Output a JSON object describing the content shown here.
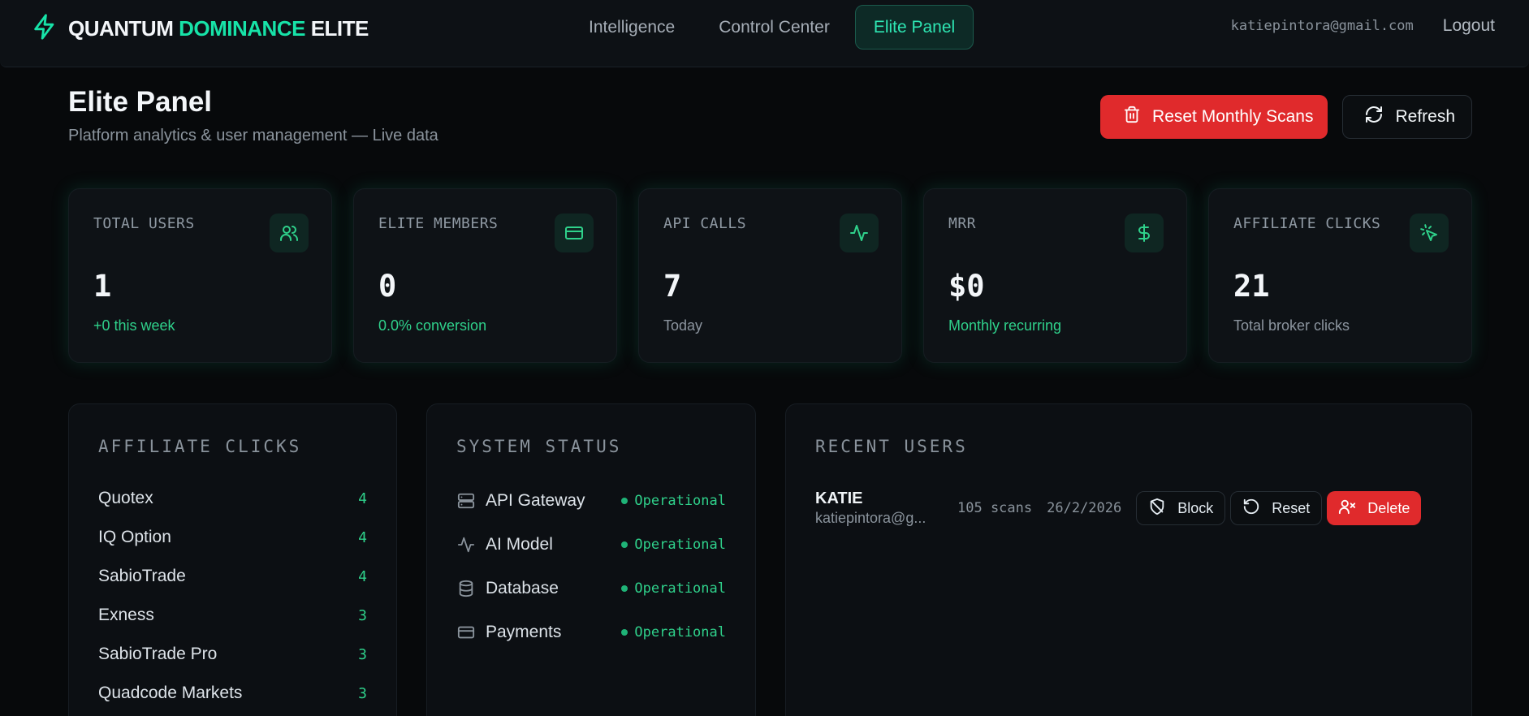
{
  "brand": {
    "part1": "QUANTUM",
    "part2": "DOMINANCE",
    "part3": "ELITE",
    "accent": "#17e3a8",
    "icon": "lightning-icon"
  },
  "nav": {
    "links": [
      {
        "label": "Intelligence"
      },
      {
        "label": "Control Center"
      },
      {
        "label": "Elite Panel",
        "active": true
      }
    ],
    "email": "katiepintora@gmail.com",
    "logout": "Logout"
  },
  "header": {
    "title": "Elite Panel",
    "subtitle": "Platform analytics & user management — Live data",
    "reset_label": "Reset Monthly Scans",
    "refresh_label": "Refresh"
  },
  "stats": [
    {
      "label": "TOTAL USERS",
      "value": "1",
      "sub": "+0 this week",
      "icon": "users-icon"
    },
    {
      "label": "ELITE MEMBERS",
      "value": "0",
      "sub": "0.0% conversion",
      "icon": "credit-card-icon"
    },
    {
      "label": "API CALLS",
      "value": "7",
      "sub": "Today",
      "icon": "activity-icon"
    },
    {
      "label": "MRR",
      "value": "$0",
      "sub": "Monthly recurring",
      "icon": "dollar-icon"
    },
    {
      "label": "AFFILIATE CLICKS",
      "value": "21",
      "sub": "Total broker clicks",
      "icon": "pointer-click-icon"
    }
  ],
  "affiliate": {
    "title": "AFFILIATE CLICKS",
    "items": [
      {
        "name": "Quotex",
        "count": "4"
      },
      {
        "name": "IQ Option",
        "count": "4"
      },
      {
        "name": "SabioTrade",
        "count": "4"
      },
      {
        "name": "Exness",
        "count": "3"
      },
      {
        "name": "SabioTrade Pro",
        "count": "3"
      },
      {
        "name": "Quadcode Markets",
        "count": "3"
      }
    ]
  },
  "system": {
    "title": "SYSTEM STATUS",
    "items": [
      {
        "name": "API Gateway",
        "status": "Operational",
        "icon": "server-icon"
      },
      {
        "name": "AI Model",
        "status": "Operational",
        "icon": "activity-icon"
      },
      {
        "name": "Database",
        "status": "Operational",
        "icon": "database-icon"
      },
      {
        "name": "Payments",
        "status": "Operational",
        "icon": "credit-card-icon"
      }
    ]
  },
  "recent": {
    "title": "RECENT USERS",
    "users": [
      {
        "name": "KATIE",
        "email": "katiepintora@g...",
        "scans": "105 scans",
        "date": "26/2/2026",
        "block": "Block",
        "reset": "Reset",
        "delete": "Delete"
      }
    ]
  }
}
